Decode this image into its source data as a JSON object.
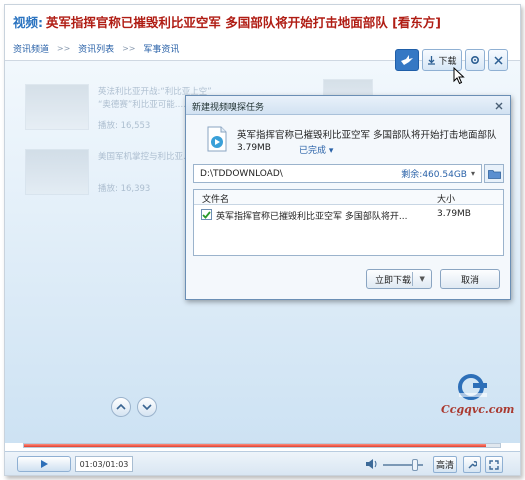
{
  "header": {
    "prefix": "视频:",
    "title": "英军指挥官称已摧毁利比亚空军 多国部队将开始打击地面部队 [看东方]"
  },
  "breadcrumb": {
    "items": [
      "资讯频道",
      "资讯列表",
      "军事资讯"
    ],
    "separator": ">>"
  },
  "toolbar": {
    "download_label": "下载"
  },
  "related": [
    {
      "line1": "英法利比亚开战:“利比亚上空”",
      "line2": "“奥德赛”利比亚可能……",
      "meta": "播放: 16,553"
    },
    {
      "line1": "美国军机掌控与利比亚……",
      "line2": "",
      "meta": "播放: 16,393"
    }
  ],
  "dialog": {
    "title": "新建视频嗅探任务",
    "file_name": "英军指挥官称已摧毁利比亚空军 多国部队将开始打击地面部队",
    "file_size": "3.79MB",
    "status": "已完成",
    "path": "D:\\TDDOWNLOAD\\",
    "free_space_label": "剩余:460.54GB",
    "table": {
      "headers": [
        "文件名",
        "大小"
      ],
      "rows": [
        {
          "name": "英军指挥官称已摧毁利比亚空军 多国部队将开...",
          "size": "3.79MB",
          "checked": true
        }
      ]
    },
    "download_now_label": "立即下载",
    "cancel_label": "取消"
  },
  "watermark": {
    "text": "Ccgqvc.com"
  },
  "player": {
    "time": "01:03/01:03",
    "progress": 0.97,
    "volume": 0.8,
    "quality_label": "高清"
  },
  "colors": {
    "title_red": "#b01d14",
    "link_blue": "#2a62a8",
    "progress_red": "#e2402f"
  }
}
